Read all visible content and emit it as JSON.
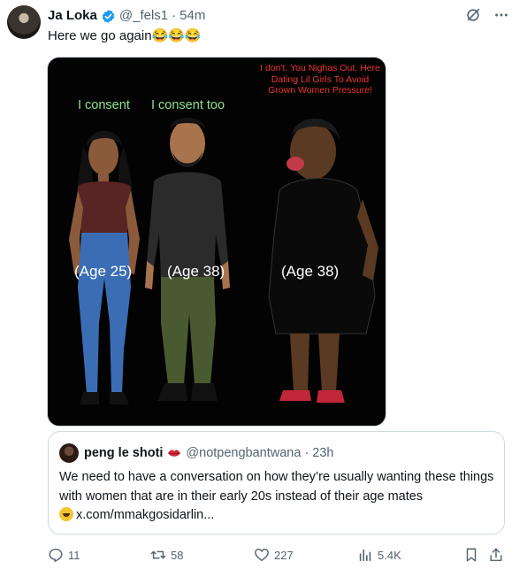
{
  "author": {
    "name": "Ja Loka",
    "handle": "@_fels1",
    "separator": "·",
    "time": "54m",
    "verified_icon": "verified-badge-icon"
  },
  "tweet": {
    "text": "Here we go again😂😂😂"
  },
  "media": {
    "consent_1": "I consent",
    "consent_2": "I consent too",
    "caption": "I don't. You Nighas Out. Here Dating Lil Girls To Avoid Grown Women Pressure!",
    "age_1": "(Age 25)",
    "age_2": "(Age 38)",
    "age_3": "(Age 38)"
  },
  "quote": {
    "name": "peng le shoti",
    "handle": "@notpengbantwana",
    "separator": "·",
    "time": "23h",
    "text": "We need to have a conversation on how they’re usually wanting these things with women that are in their early 20s instead of their age mates",
    "link": "x.com/mmakgosidarlin..."
  },
  "actions": {
    "replies": "11",
    "reposts": "58",
    "likes": "227",
    "views": "5.4K"
  },
  "colors": {
    "verified": "#1d9bf0",
    "muted": "#536471",
    "consent_green": "#8fe08f",
    "caption_red": "#e33333"
  }
}
